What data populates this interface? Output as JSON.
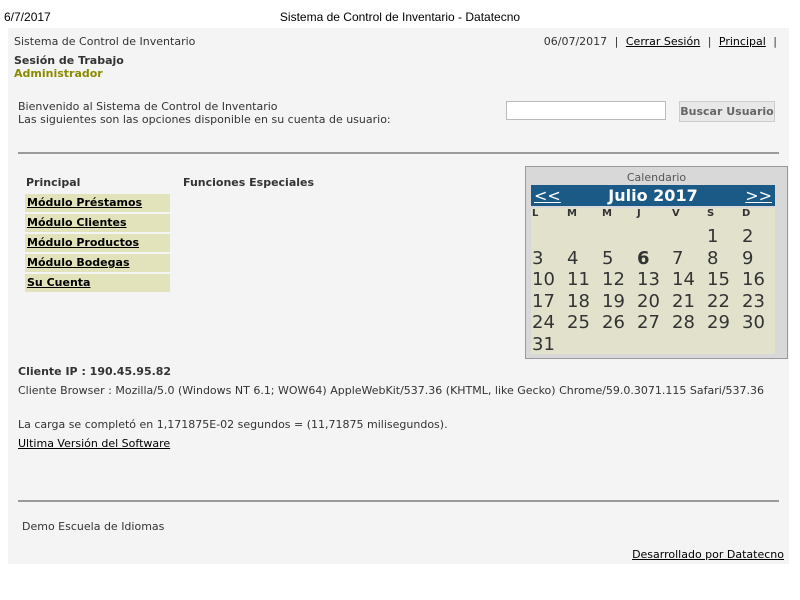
{
  "print_header": {
    "date": "6/7/2017",
    "title": "Sistema de Control de Inventario - Datatecno"
  },
  "header": {
    "system_title": "Sistema de Control de Inventario",
    "date": "06/07/2017",
    "separator": "|",
    "logout_label": "Cerrar Sesión",
    "principal_label": "Principal"
  },
  "session": {
    "label": "Sesión de Trabajo",
    "user": "Administrador"
  },
  "welcome": {
    "line1": "Bienvenido al Sistema de Control de Inventario",
    "line2": "Las siguientes son las opciones disponible en su cuenta de usuario:"
  },
  "search": {
    "value": "",
    "button_label": "Buscar Usuario"
  },
  "menu": {
    "heading": "Principal",
    "items": [
      "Módulo Préstamos",
      "Módulo Clientes",
      "Módulo Productos",
      "Módulo Bodegas",
      "Su Cuenta"
    ]
  },
  "special": {
    "heading": "Funciones Especiales"
  },
  "calendar": {
    "title": "Calendario",
    "prev": "<<",
    "next": ">>",
    "month": "Julio 2017",
    "day_headers": [
      "L",
      "M",
      "M",
      "J",
      "V",
      "S",
      "D"
    ],
    "first_weekday_index": 5,
    "days_in_month": 31,
    "today": 6
  },
  "info": {
    "ip": "Cliente IP : 190.45.95.82",
    "browser": "Cliente Browser : Mozilla/5.0 (Windows NT 6.1; WOW64) AppleWebKit/537.36 (KHTML, like Gecko) Chrome/59.0.3071.115 Safari/537.36",
    "load": "La carga se completó en 1,171875E-02 segundos = (11,71875 milisegundos).",
    "version_link": "Ultima Versión del Software"
  },
  "footer": {
    "school": "Demo Escuela de Idiomas",
    "developer_link": "Desarrollado por Datatecno"
  }
}
